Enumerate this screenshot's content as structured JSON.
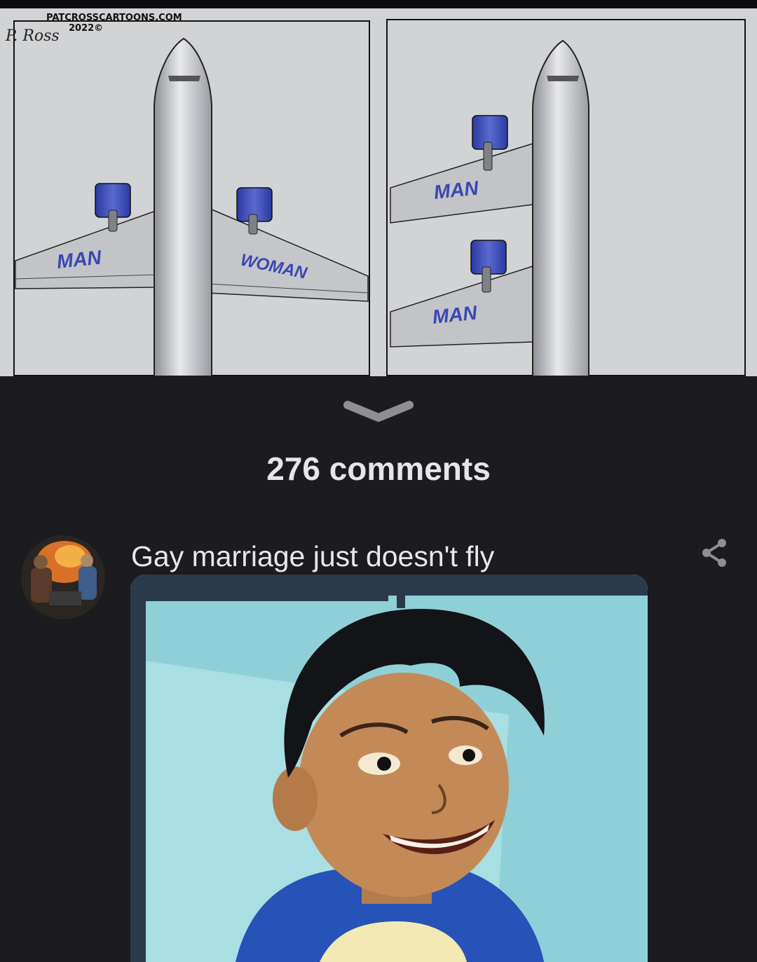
{
  "post": {
    "comic": {
      "credit_line1": "PATCROSSCARTOONS.COM",
      "credit_line2": "2022©",
      "signature": "P. Ross",
      "panel_left": {
        "wing_left_label": "MAN",
        "wing_right_label": "WOMAN"
      },
      "panel_right": {
        "wing_top_label": "MAN",
        "wing_bottom_label": "MAN"
      }
    }
  },
  "comments_header": {
    "count_label": "276 comments"
  },
  "comment": {
    "text": "Gay marriage just doesn't fly",
    "avatar_icon": "user-avatar",
    "share_icon": "share-icon"
  },
  "colors": {
    "page_bg": "#1b1b20",
    "comic_bg": "#d2d3d5",
    "engine_blue": "#3b4cb0",
    "text_primary": "#e8e8ec",
    "icon_gray": "#8e8e94"
  }
}
